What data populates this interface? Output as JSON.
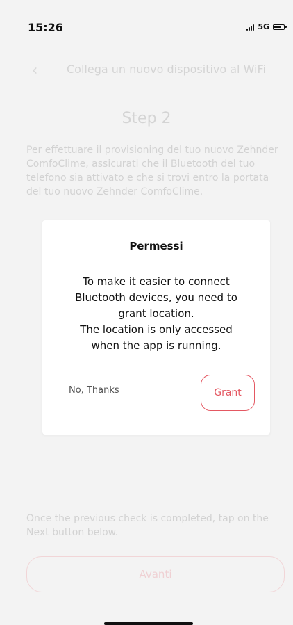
{
  "status_bar": {
    "time": "15:26",
    "network": "5G"
  },
  "header": {
    "title": "Collega un nuovo dispositivo al WiFi",
    "back_icon": "chevron-left-icon"
  },
  "content": {
    "step_title": "Step 2",
    "intro_text": "Per effettuare il provisioning del tuo nuovo Zehnder ComfoClime, assicurati che il Bluetooth del tuo telefono sia attivato e che si trovi entro la portata del tuo nuovo Zehnder ComfoClime.",
    "bottom_text": "Once the previous check is completed, tap on the Next button below.",
    "next_button_label": "Avanti"
  },
  "dialog": {
    "title": "Permessi",
    "message_lines": [
      "To make it easier to connect",
      "Bluetooth devices, you need to",
      "grant location.",
      "The location is only accessed",
      "when the app is running."
    ],
    "cancel_label": "No, Thanks",
    "confirm_label": "Grant"
  },
  "colors": {
    "accent": "#e45862",
    "background": "#f3f3f3",
    "faded_text": "#d4d4d4"
  }
}
